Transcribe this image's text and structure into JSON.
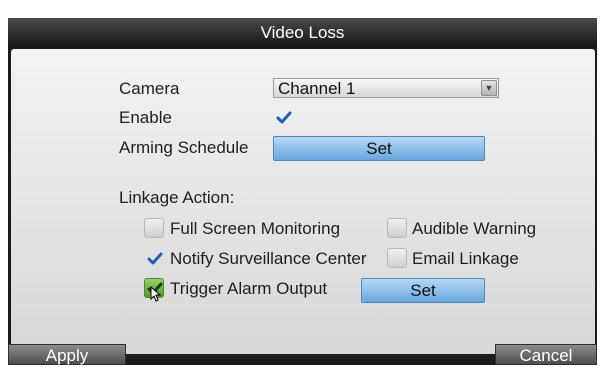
{
  "dialog": {
    "title": "Video Loss",
    "camera_label": "Camera",
    "camera_value": "Channel 1",
    "enable_label": "Enable",
    "enable_checked": true,
    "arming_schedule_label": "Arming Schedule",
    "arming_schedule_button": "Set",
    "linkage_action_label": "Linkage Action:",
    "options": {
      "full_screen_monitoring": {
        "label": "Full Screen Monitoring",
        "checked": false
      },
      "audible_warning": {
        "label": "Audible Warning",
        "checked": false
      },
      "notify_surveillance_center": {
        "label": "Notify Surveillance Center",
        "checked": true
      },
      "email_linkage": {
        "label": "Email Linkage",
        "checked": false
      },
      "trigger_alarm_output": {
        "label": "Trigger Alarm Output",
        "checked": true
      }
    },
    "trigger_set_button": "Set"
  },
  "footer": {
    "apply_label": "Apply",
    "cancel_label": "Cancel"
  },
  "colors": {
    "accent_button": "#6aa6dd",
    "check_blue": "#1f5fb5",
    "check_green": "#4e9a2a"
  }
}
